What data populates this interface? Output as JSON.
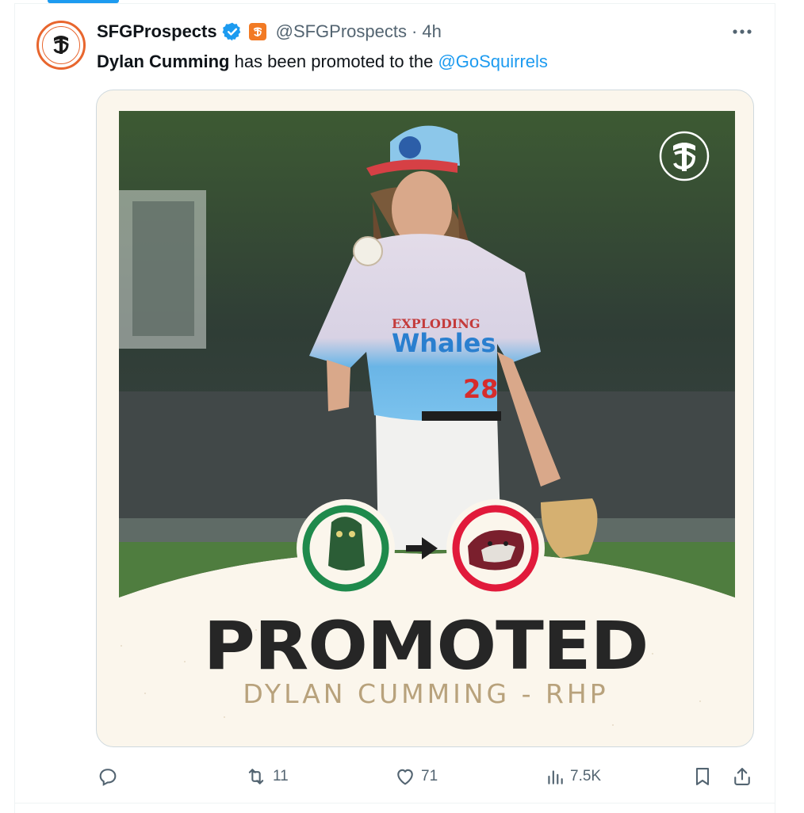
{
  "post": {
    "display_name": "SFGProspects",
    "handle": "@SFGProspects",
    "separator": "·",
    "time": "4h",
    "text_bold": "Dylan Cumming",
    "text_middle": " has been promoted to the ",
    "mention": "@GoSquirrels"
  },
  "graphic": {
    "headline": "PROMOTED",
    "subline": "DYLAN CUMMING - RHP",
    "jersey_team": "EXPLODING Whales",
    "jersey_number": "28",
    "from_team_ring_color": "#1f8a4c",
    "to_team_ring_color": "#e11a3b"
  },
  "actions": {
    "reply_count": "",
    "retweet_count": "11",
    "like_count": "71",
    "views_count": "7.5K"
  },
  "colors": {
    "accent": "#1d9bf0",
    "muted": "#536471",
    "brand_orange": "#f27a24"
  },
  "icons": [
    "verified-icon",
    "giants-badge-icon",
    "more-icon",
    "reply-icon",
    "retweet-icon",
    "like-icon",
    "views-icon",
    "bookmark-icon",
    "share-icon"
  ]
}
